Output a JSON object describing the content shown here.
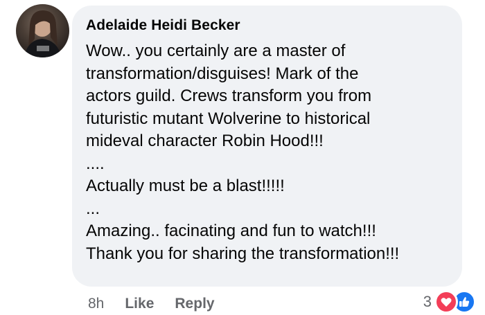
{
  "comment": {
    "author": "Adelaide Heidi Becker",
    "lines": [
      "Wow.. you certainly are a master of",
      "transformation/disguises! Mark of the",
      "actors guild. Crews transform you from",
      "futuristic mutant Wolverine to historical",
      "mideval character Robin Hood!!!",
      "....",
      "Actually must be a blast!!!!!",
      "...",
      "Amazing.. facinating and fun to watch!!!",
      "Thank you for sharing the transformation!!!"
    ]
  },
  "actions": {
    "time": "8h",
    "like_label": "Like",
    "reply_label": "Reply"
  },
  "reactions": {
    "count": "3",
    "types": [
      "heart-icon",
      "thumbs-up-icon"
    ],
    "colors": {
      "heart": "#f33e58",
      "like": "#1877f2"
    }
  },
  "theme": {
    "bubble_bg": "#f0f2f5",
    "meta_text": "#65676b",
    "text": "#050505"
  }
}
